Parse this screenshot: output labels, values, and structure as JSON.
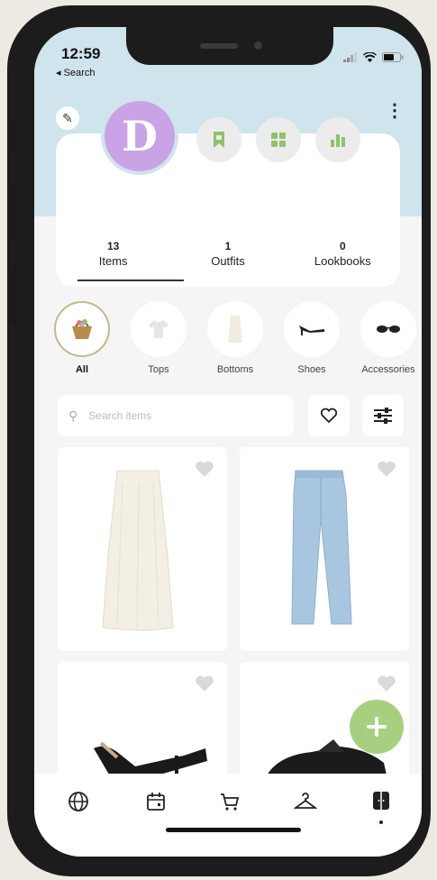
{
  "status_bar": {
    "time": "12:59",
    "back_label": "◂ Search"
  },
  "profile": {
    "avatar_initial": "D"
  },
  "stats": [
    {
      "value": "13",
      "label": "Items"
    },
    {
      "value": "1",
      "label": "Outfits"
    },
    {
      "value": "0",
      "label": "Lookbooks"
    }
  ],
  "categories": [
    {
      "label": "All",
      "icon": "basket-icon",
      "active": true
    },
    {
      "label": "Tops",
      "icon": "tshirt-icon",
      "active": false
    },
    {
      "label": "Bottoms",
      "icon": "skirt-icon",
      "active": false
    },
    {
      "label": "Shoes",
      "icon": "heel-icon",
      "active": false
    },
    {
      "label": "Accessories",
      "icon": "sunglasses-icon",
      "active": false
    }
  ],
  "search": {
    "placeholder": "Search items"
  },
  "items": [
    {
      "name": "white-satin-skirt",
      "icon": "skirt-image"
    },
    {
      "name": "light-blue-jeans",
      "icon": "jeans-image"
    },
    {
      "name": "black-slingback-heels",
      "icon": "heels-image"
    },
    {
      "name": "black-loafers",
      "icon": "loafers-image"
    }
  ],
  "colors": {
    "header_bg": "#cfe4ec",
    "avatar": "#c9a3e6",
    "accent_green": "#a6d080",
    "icon_green": "#8fc26a"
  },
  "bottom_nav": [
    "globe-icon",
    "calendar-icon",
    "cart-icon",
    "hanger-icon",
    "wardrobe-icon"
  ]
}
